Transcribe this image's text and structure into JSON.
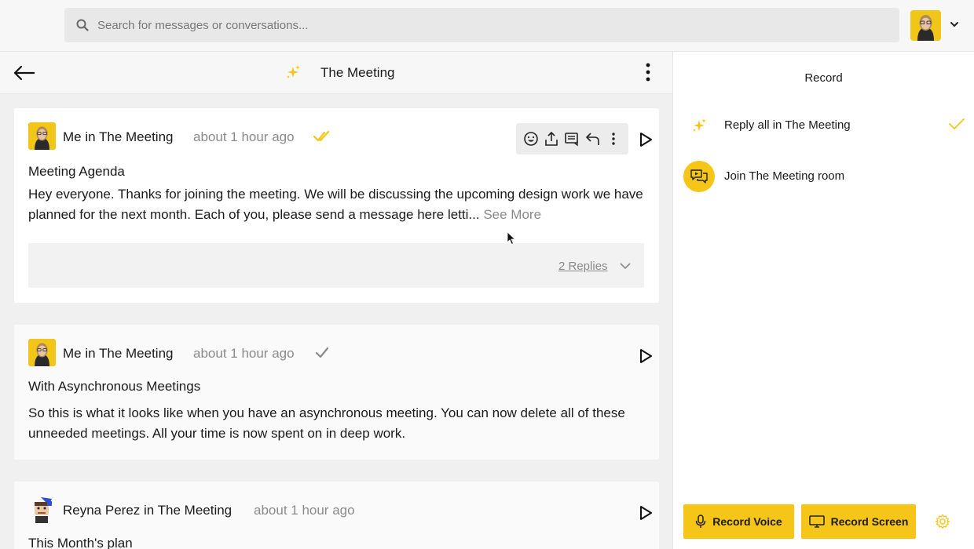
{
  "search": {
    "placeholder": "Search for messages or conversations..."
  },
  "conversation": {
    "title": "The Meeting"
  },
  "messages": [
    {
      "sender": "Me in The Meeting",
      "time": "about 1 hour ago",
      "subject": "Meeting Agenda",
      "body": "Hey everyone. Thanks for joining the meeting. We will be discussing the upcoming design work we have planned for the next month. Each of you, please send a message here letti...",
      "see_more": "See More",
      "replies": "2 Replies",
      "status": "read"
    },
    {
      "sender": "Me in The Meeting",
      "time": "about 1 hour ago",
      "subject": "With Asynchronous Meetings",
      "body": "So this is what it looks like when you have an asynchronous meeting. You can now delete all of these unneeded meetings. All your time is now spent on in deep work.",
      "status": "sent"
    },
    {
      "sender": "Reyna Perez in The Meeting",
      "time": "about 1 hour ago",
      "subject": "This Month's plan"
    }
  ],
  "record_panel": {
    "title": "Record",
    "items": [
      {
        "label": "Reply all in The Meeting",
        "icon": "sparkle-icon",
        "selected": true
      },
      {
        "label": "Join The Meeting room",
        "icon": "chat-bubbles-icon",
        "selected": false
      }
    ],
    "record_voice": "Record Voice",
    "record_screen": "Record Screen"
  },
  "colors": {
    "accent": "#f5c518",
    "muted_text": "#8a8a8a"
  }
}
